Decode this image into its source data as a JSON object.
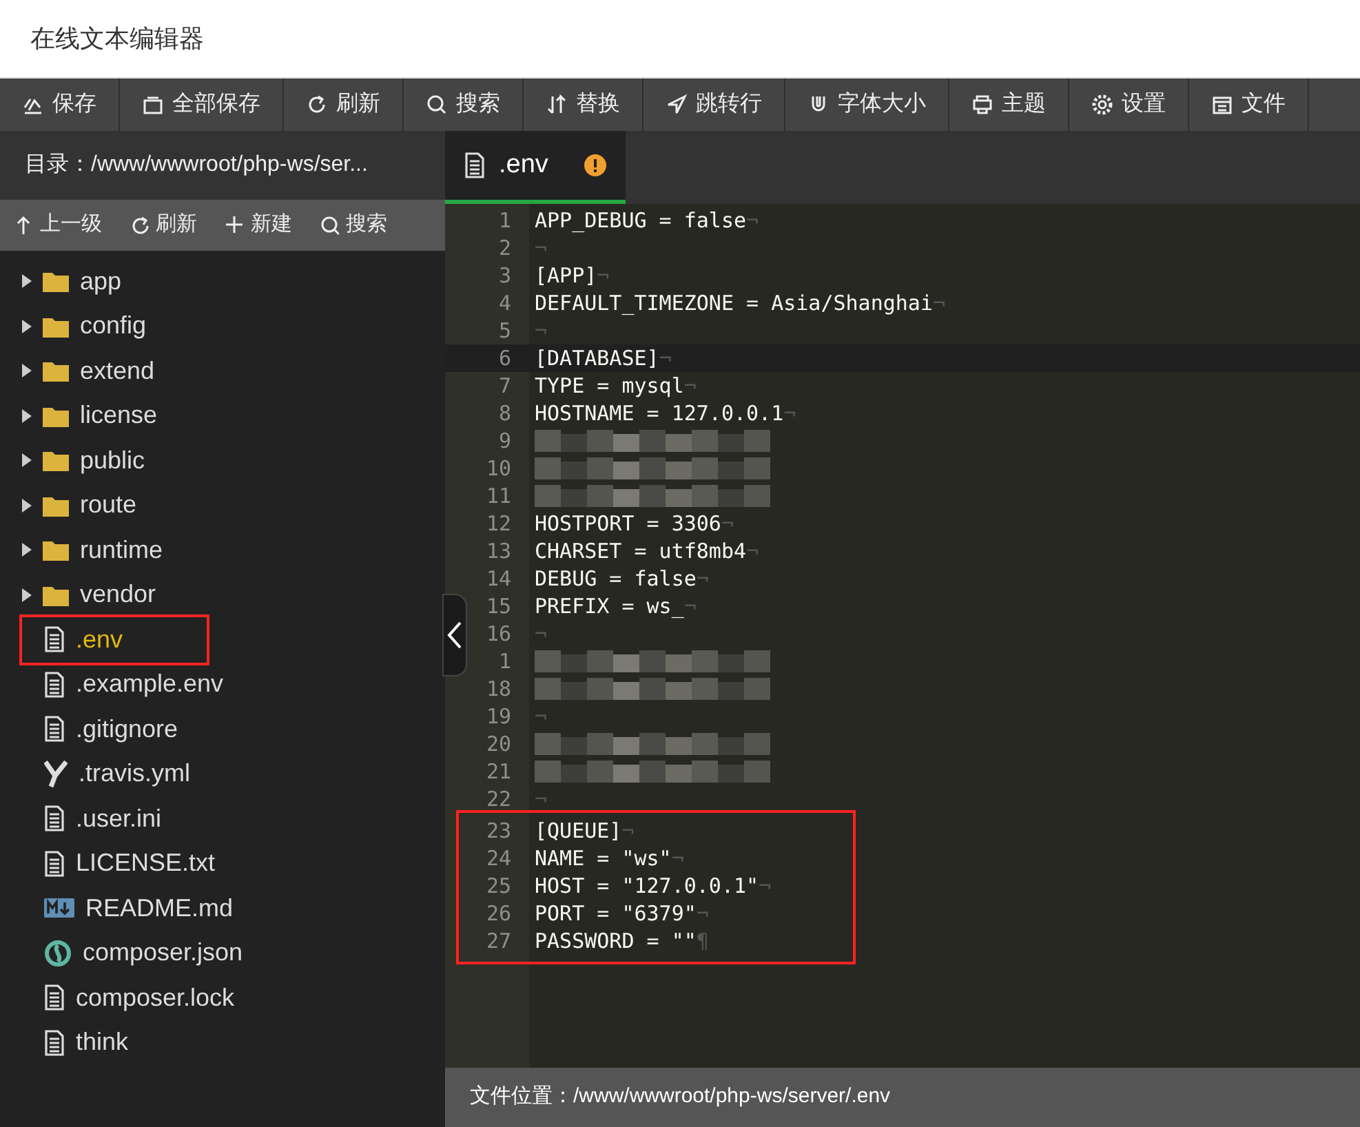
{
  "window": {
    "title": "在线文本编辑器"
  },
  "toolbar": [
    {
      "label": "保存"
    },
    {
      "label": "全部保存"
    },
    {
      "label": "刷新"
    },
    {
      "label": "搜索"
    },
    {
      "label": "替换"
    },
    {
      "label": "跳转行"
    },
    {
      "label": "字体大小"
    },
    {
      "label": "主题"
    },
    {
      "label": "设置"
    },
    {
      "label": "文件"
    }
  ],
  "sidebar": {
    "path": "目录：/www/wwwroot/php-ws/ser...",
    "actions": [
      {
        "label": "上一级"
      },
      {
        "label": "刷新"
      },
      {
        "label": "新建"
      },
      {
        "label": "搜索"
      }
    ],
    "items": [
      {
        "name": "app",
        "kind": "folder",
        "selected": false
      },
      {
        "name": "config",
        "kind": "folder",
        "selected": false
      },
      {
        "name": "extend",
        "kind": "folder",
        "selected": false
      },
      {
        "name": "license",
        "kind": "folder",
        "selected": false
      },
      {
        "name": "public",
        "kind": "folder",
        "selected": false
      },
      {
        "name": "route",
        "kind": "folder",
        "selected": false
      },
      {
        "name": "runtime",
        "kind": "folder",
        "selected": false
      },
      {
        "name": "vendor",
        "kind": "folder",
        "selected": false
      },
      {
        "name": ".env",
        "kind": "file",
        "selected": true,
        "boxed": true
      },
      {
        "name": ".example.env",
        "kind": "file",
        "selected": false
      },
      {
        "name": ".gitignore",
        "kind": "file",
        "selected": false
      },
      {
        "name": ".travis.yml",
        "kind": "yaml",
        "selected": false
      },
      {
        "name": ".user.ini",
        "kind": "file",
        "selected": false
      },
      {
        "name": "LICENSE.txt",
        "kind": "file",
        "selected": false
      },
      {
        "name": "README.md",
        "kind": "markdown",
        "selected": false
      },
      {
        "name": "composer.json",
        "kind": "json",
        "selected": false
      },
      {
        "name": "composer.lock",
        "kind": "file",
        "selected": false
      },
      {
        "name": "think",
        "kind": "file",
        "selected": false
      }
    ]
  },
  "tabs": [
    {
      "label": ".env",
      "selected": true,
      "modified": true
    }
  ],
  "editor": {
    "lines": [
      {
        "n": "1",
        "text": "APP_DEBUG = false",
        "eol": "¬"
      },
      {
        "n": "2",
        "eol": "¬"
      },
      {
        "n": "3",
        "text": "[APP]",
        "eol": "¬"
      },
      {
        "n": "4",
        "text": "DEFAULT_TIMEZONE = Asia/Shanghai",
        "eol": "¬"
      },
      {
        "n": "5",
        "eol": "¬"
      },
      {
        "n": "6",
        "text": "[DATABASE]",
        "eol": "¬",
        "active": true
      },
      {
        "n": "7",
        "text": "TYPE = mysql",
        "eol": "¬"
      },
      {
        "n": "8",
        "text": "HOSTNAME = 127.0.0.1",
        "eol": "¬"
      },
      {
        "n": "9",
        "redacted": true
      },
      {
        "n": "10",
        "redacted": true
      },
      {
        "n": "11",
        "redacted": true
      },
      {
        "n": "12",
        "text": "HOSTPORT = 3306",
        "eol": "¬"
      },
      {
        "n": "13",
        "text": "CHARSET = utf8mb4",
        "eol": "¬"
      },
      {
        "n": "14",
        "text": "DEBUG = false",
        "eol": "¬"
      },
      {
        "n": "15",
        "text": "PREFIX = ws_",
        "eol": "¬"
      },
      {
        "n": "16",
        "eol": "¬"
      },
      {
        "n": "1",
        "redacted": true
      },
      {
        "n": "18",
        "redacted": true
      },
      {
        "n": "19",
        "eol": "¬"
      },
      {
        "n": "20",
        "redacted": true
      },
      {
        "n": "21",
        "redacted": true
      },
      {
        "n": "22",
        "eol": "¬"
      },
      {
        "n": "23",
        "text": "[QUEUE]",
        "eol": "¬",
        "boxed": true
      },
      {
        "n": "24",
        "text": "NAME = \"ws\"",
        "eol": "¬",
        "boxed": true
      },
      {
        "n": "25",
        "text": "HOST = \"127.0.0.1\"",
        "eol": "¬",
        "boxed": true
      },
      {
        "n": "26",
        "text": "PORT = \"6379\"",
        "eol": "¬",
        "boxed": true
      },
      {
        "n": "27",
        "text": "PASSWORD = \"\"",
        "eol": "¶",
        "boxed": true
      }
    ]
  },
  "status_bar": {
    "text": "文件位置：/www/wwwroot/php-ws/server/.env"
  }
}
